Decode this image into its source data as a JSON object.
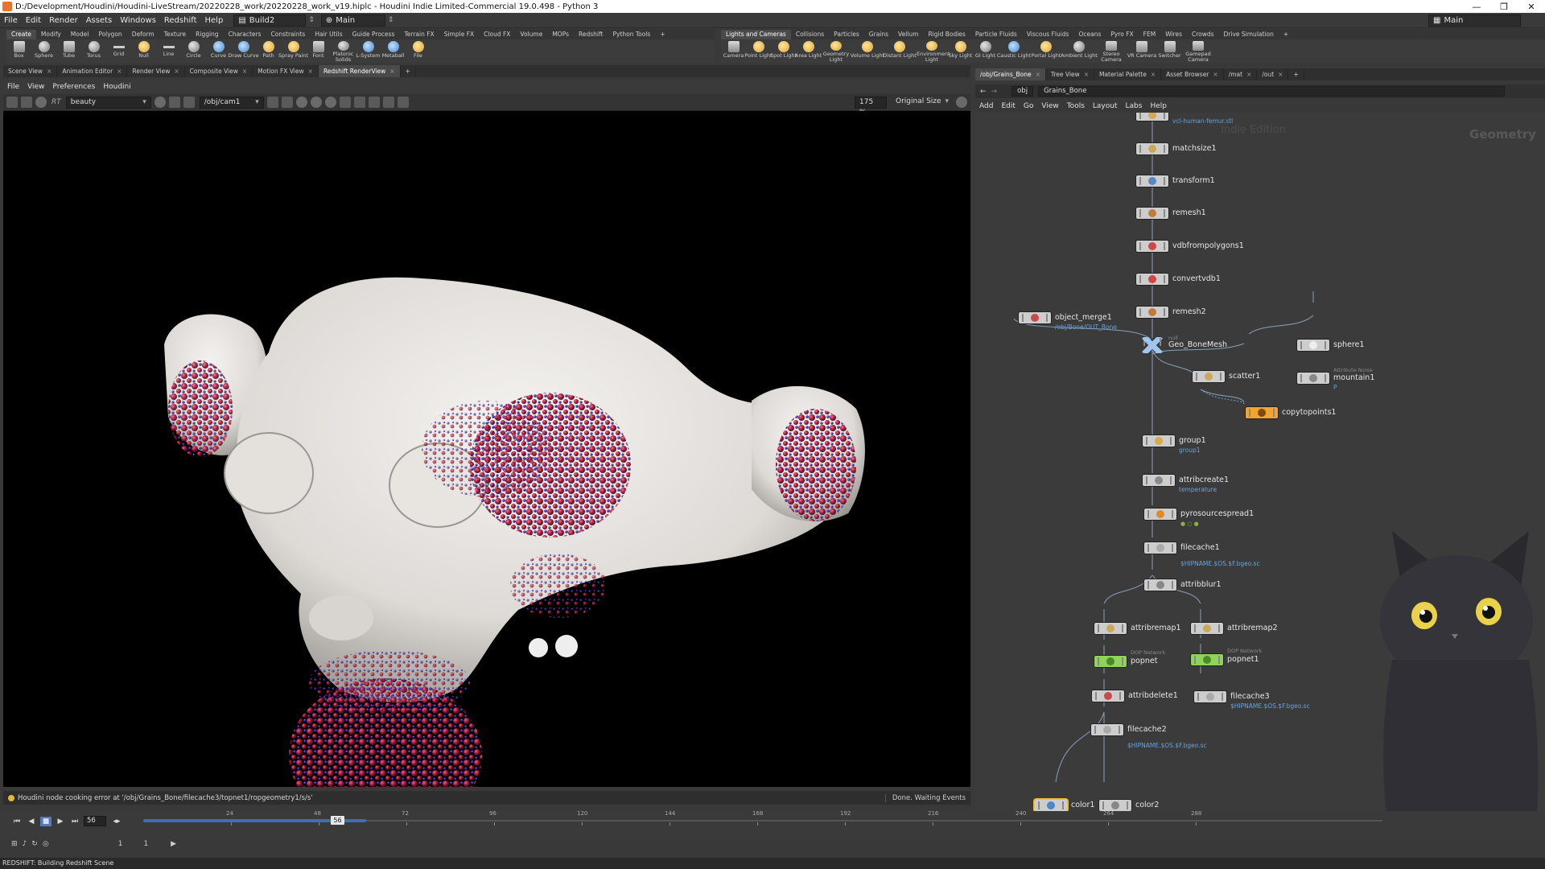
{
  "window": {
    "title": "D:/Development/Houdini/Houdini-LiveStream/20220228_work/20220228_work_v19.hiplc - Houdini Indie Limited-Commercial 19.0.498 - Python 3",
    "min": "—",
    "max": "❐",
    "close": "✕"
  },
  "menu": {
    "items": [
      "File",
      "Edit",
      "Render",
      "Assets",
      "Windows",
      "Redshift",
      "Help"
    ],
    "desktop": "Build2",
    "desktop_arrow": "⇕",
    "context": "Main",
    "context_arrow": "⇕",
    "right_desktop": "Main"
  },
  "shelf_left": {
    "tabs": [
      "Create",
      "Modify",
      "Model",
      "Polygon",
      "Deform",
      "Texture",
      "Rigging",
      "Characters",
      "Constraints",
      "Hair Utils",
      "Guide Process",
      "Terrain FX",
      "Simple FX",
      "Cloud FX",
      "Volume",
      "MOPs",
      "Redshift",
      "Python Tools"
    ],
    "tools": [
      "Box",
      "Sphere",
      "Tube",
      "Torus",
      "Grid",
      "Null",
      "Line",
      "Circle",
      "Curve",
      "Draw Curve",
      "Path",
      "Spray Paint",
      "Font",
      "Platonic Solids",
      "L-System",
      "Metaball",
      "File"
    ]
  },
  "shelf_right": {
    "tabs": [
      "Lights and Cameras",
      "Collisions",
      "Particles",
      "Grains",
      "Vellum",
      "Rigid Bodies",
      "Particle Fluids",
      "Viscous Fluids",
      "Oceans",
      "Pyro FX",
      "FEM",
      "Wires",
      "Crowds",
      "Drive Simulation"
    ],
    "tools": [
      "Camera",
      "Point Light",
      "Spot Light",
      "Area Light",
      "Geometry Light",
      "Volume Light",
      "Distant Light",
      "Environment Light",
      "Sky Light",
      "GI Light",
      "Caustic Light",
      "Portal Light",
      "Ambient Light",
      "Stereo Camera",
      "VR Camera",
      "Switcher",
      "Gamepad Camera"
    ]
  },
  "viewer": {
    "tabs": [
      "Scene View",
      "Animation Editor",
      "Render View",
      "Composite View",
      "Motion FX View",
      "Redshift RenderView"
    ],
    "menus": [
      "File",
      "View",
      "Preferences",
      "Houdini"
    ],
    "aov": "beauty",
    "camera": "/obj/cam1",
    "zoom": "175 %",
    "size_mode": "Original Size",
    "rt_label": "RT",
    "error": "Houdini node cooking error at '/obj/Grains_Bone/filecache3/topnet1/ropgeometry1/s/s'",
    "status": "Done. Waiting Events"
  },
  "timeline": {
    "current_frame": "56",
    "frame_field": "56",
    "range_start": "1",
    "range_end": "1",
    "ticks": [
      "24",
      "48",
      "72",
      "96",
      "120",
      "144",
      "168",
      "192",
      "216",
      "240",
      "264",
      "288"
    ],
    "progress": 0.18,
    "marker": 0.151
  },
  "statusbar": {
    "text": "REDSHIFT: Building Redshift Scene"
  },
  "network": {
    "tabs": [
      "/obj/Grains_Bone",
      "Tree View",
      "Material Palette",
      "Asset Browser",
      "/mat",
      "/out"
    ],
    "path": [
      "obj",
      "Grains_Bone"
    ],
    "menus": [
      "Add",
      "Edit",
      "Go",
      "View",
      "Tools",
      "Layout",
      "Labs",
      "Help"
    ],
    "watermark": "Indie Edition",
    "context_label": "Geometry",
    "nodes": [
      {
        "id": "top",
        "name": "",
        "sub": "vcl-human-femur.stl"
      },
      {
        "id": "matchsize1",
        "name": "matchsize1"
      },
      {
        "id": "transform1",
        "name": "transform1"
      },
      {
        "id": "remesh1",
        "name": "remesh1"
      },
      {
        "id": "vdbfrompolygons1",
        "name": "vdbfrompolygons1"
      },
      {
        "id": "convertvdb1",
        "name": "convertvdb1"
      },
      {
        "id": "remesh2",
        "name": "remesh2"
      },
      {
        "id": "object_merge1",
        "name": "object_merge1",
        "sub": "/obj/Bone/OUT_Bone"
      },
      {
        "id": "geo_bonemesh",
        "name": "Geo_BoneMesh",
        "desc": "null"
      },
      {
        "id": "sphere1",
        "name": "sphere1"
      },
      {
        "id": "scatter1",
        "name": "scatter1"
      },
      {
        "id": "mountain1",
        "name": "mountain1",
        "desc": "Attribute Noise",
        "sub": "P"
      },
      {
        "id": "copytopoints1",
        "name": "copytopoints1"
      },
      {
        "id": "group1",
        "name": "group1",
        "sub": "group1"
      },
      {
        "id": "attribcreate1",
        "name": "attribcreate1",
        "sub": "temperature"
      },
      {
        "id": "pyrosourcespread1",
        "name": "pyrosourcespread1"
      },
      {
        "id": "filecache1",
        "name": "filecache1",
        "sub": "$HIPNAME.$OS.$F.bgeo.sc"
      },
      {
        "id": "attribblur1",
        "name": "attribblur1"
      },
      {
        "id": "attribremap1",
        "name": "attribremap1"
      },
      {
        "id": "attribremap2",
        "name": "attribremap2"
      },
      {
        "id": "popnet",
        "name": "popnet",
        "desc": "DOP Network"
      },
      {
        "id": "popnet1",
        "name": "popnet1",
        "desc": "DOP Network"
      },
      {
        "id": "attribdelete1",
        "name": "attribdelete1"
      },
      {
        "id": "filecache3",
        "name": "filecache3",
        "sub": "$HIPNAME.$OS.$F.bgeo.sc"
      },
      {
        "id": "filecache2",
        "name": "filecache2",
        "sub": "$HIPNAME.$OS.$F.bgeo.sc"
      },
      {
        "id": "color1",
        "name": "color1"
      },
      {
        "id": "color2",
        "name": "color2"
      }
    ]
  }
}
